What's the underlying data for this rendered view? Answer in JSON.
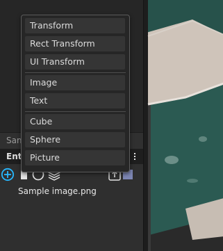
{
  "panel": {
    "tab_sample": "Sample",
    "tab_entities": "Entities"
  },
  "asset": {
    "file_name": "Sample image.png",
    "swatch_color": "#7d86b3"
  },
  "toolbar_icons": [
    "plus-circle-icon",
    "square-icon",
    "circle-icon",
    "layers-icon",
    "upload-icon",
    "color-swatch"
  ],
  "add_menu": {
    "groups": [
      [
        "Transform",
        "Rect Transform",
        "UI Transform"
      ],
      [
        "Image",
        "Text"
      ],
      [
        "Cube",
        "Sphere",
        "Picture"
      ]
    ]
  },
  "colors": {
    "accent": "#27b8ff",
    "menu_bg": "#262626",
    "menu_item_bg": "#353535"
  }
}
